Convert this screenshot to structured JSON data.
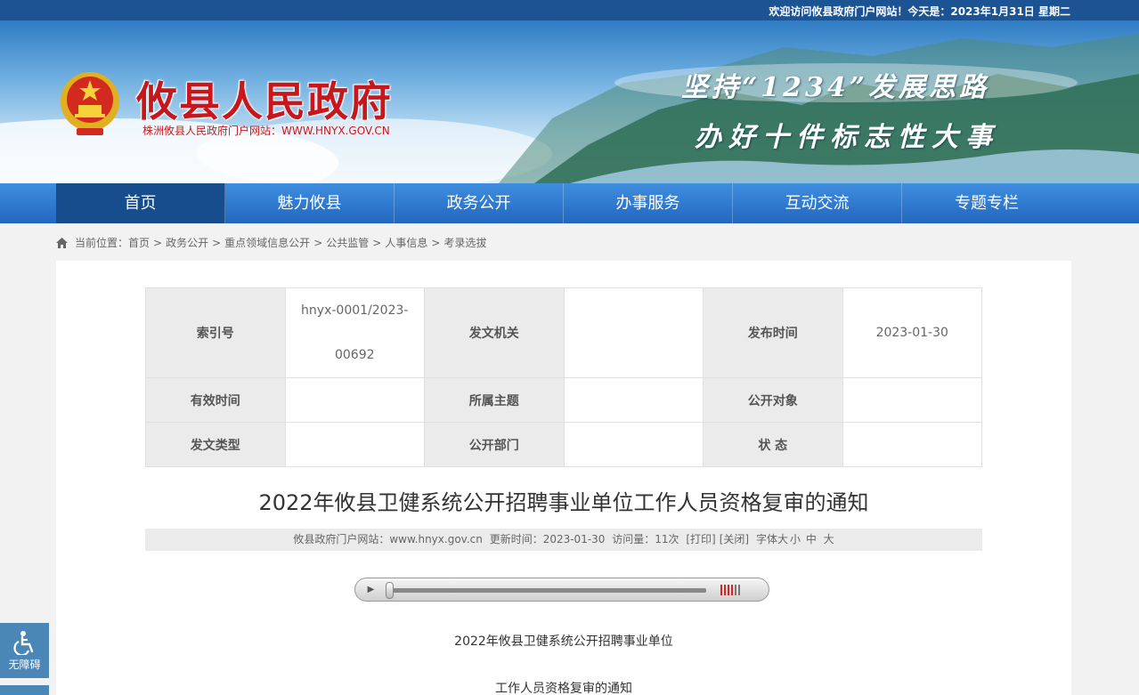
{
  "topbar": {
    "greeting": "欢迎访问攸县政府门户网站！今天是：2023年1月31日 星期二"
  },
  "header": {
    "site_title": "攸县人民政府",
    "site_subtitle": "株洲攸县人民政府门户网站：WWW.HNYX.GOV.CN",
    "slogan_1": "坚持“1234”发展思路",
    "slogan_2": "办好十件标志性大事"
  },
  "nav": {
    "items": [
      {
        "label": "首页"
      },
      {
        "label": "魅力攸县"
      },
      {
        "label": "政务公开"
      },
      {
        "label": "办事服务"
      },
      {
        "label": "互动交流"
      },
      {
        "label": "专题专栏"
      }
    ]
  },
  "breadcrumb": {
    "prefix": "当前位置：",
    "items": [
      {
        "label": "首页"
      },
      {
        "label": "政务公开"
      },
      {
        "label": "重点领域信息公开"
      },
      {
        "label": "公共监管"
      },
      {
        "label": "人事信息"
      },
      {
        "label": "考录选拔"
      }
    ],
    "sep": ">"
  },
  "meta": {
    "index_label": "索引号",
    "index_value_line1": "hnyx-0001/2023-",
    "index_value_line2": "00692",
    "issuer_label": "发文机关",
    "issuer_value": "",
    "date_label": "发布时间",
    "date_value": "2023-01-30",
    "valid_label": "有效时间",
    "valid_value": "",
    "topic_label": "所属主题",
    "topic_value": "",
    "audience_label": "公开对象",
    "audience_value": "",
    "doctype_label": "发文类型",
    "doctype_value": "",
    "dept_label": "公开部门",
    "dept_value": "",
    "status_label": "状 态",
    "status_value": ""
  },
  "article": {
    "title": "2022年攸县卫健系统公开招聘事业单位工作人员资格复审的通知",
    "source": "攸县政府门户网站：www.hnyx.gov.cn",
    "updated": "更新时间：2023-01-30",
    "visits": "访问量：11次",
    "print": "[打印]",
    "close": "[关闭]",
    "font_label": "字体大",
    "font_small": "小",
    "font_medium": "中",
    "font_large": "大",
    "para_1": "2022年攸县卫健系统公开招聘事业单位",
    "para_2": "工作人员资格复审的通知"
  },
  "accessibility": {
    "label": "无障碍"
  },
  "colors": {
    "topbar": "#1c5393",
    "nav": "#2a72c8",
    "nav_active": "#174c8d",
    "title_red": "#c8161d",
    "accessibility": "#4a86b6"
  },
  "icons": [
    "home-icon",
    "national-emblem-icon",
    "play-icon",
    "accessibility-icon"
  ]
}
